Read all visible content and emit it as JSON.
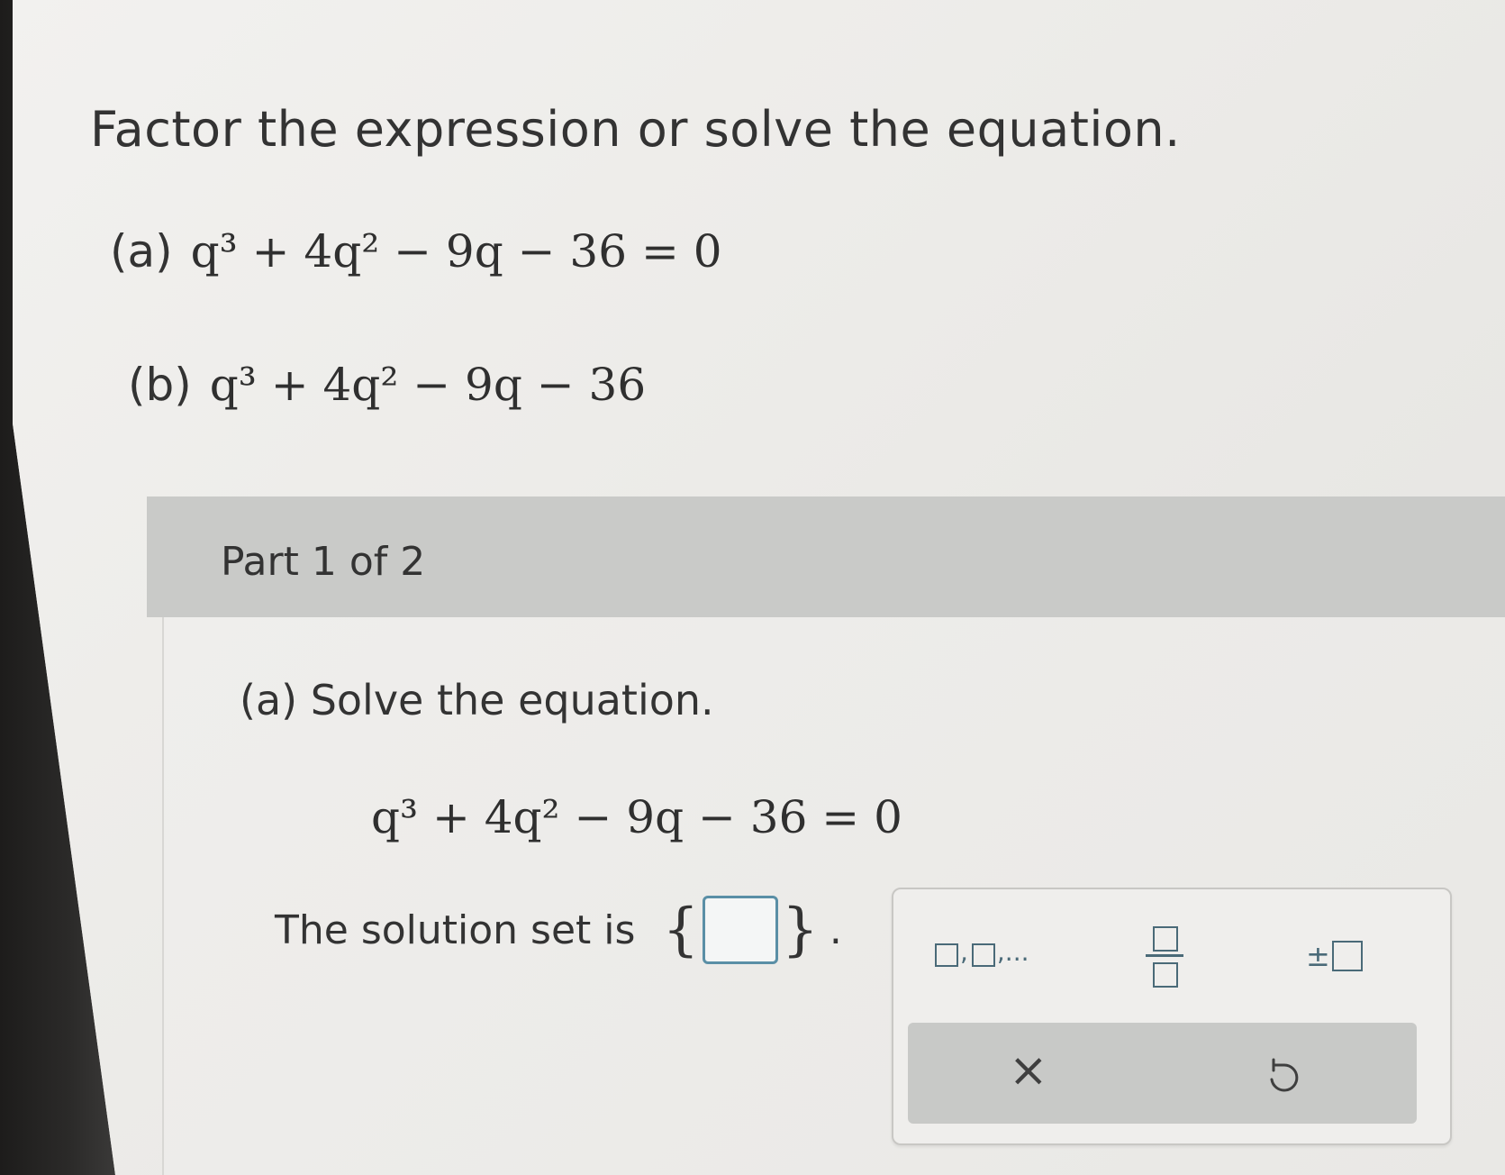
{
  "instructions": "Factor the expression or solve the equation.",
  "problems": [
    {
      "label": "(a)",
      "math": "q³ + 4q² − 9q − 36 = 0"
    },
    {
      "label": "(b)",
      "math": "q³ + 4q² − 9q − 36"
    }
  ],
  "part": {
    "title": "Part 1 of 2",
    "sub_question": "(a) Solve the equation.",
    "equation": "q³ + 4q² − 9q − 36 = 0",
    "solution_prefix": "The solution set is",
    "brace_open": "{",
    "brace_close": "}",
    "period": ".",
    "answer_value": ""
  },
  "toolbox": {
    "list_separator": ",",
    "list_ellipsis": ",...",
    "plus_minus": "±",
    "clear_symbol": "×"
  },
  "colors": {
    "accent": "#4a6a78",
    "answer_border": "#5a8fa6",
    "part_header_bg": "#c9cac8"
  }
}
